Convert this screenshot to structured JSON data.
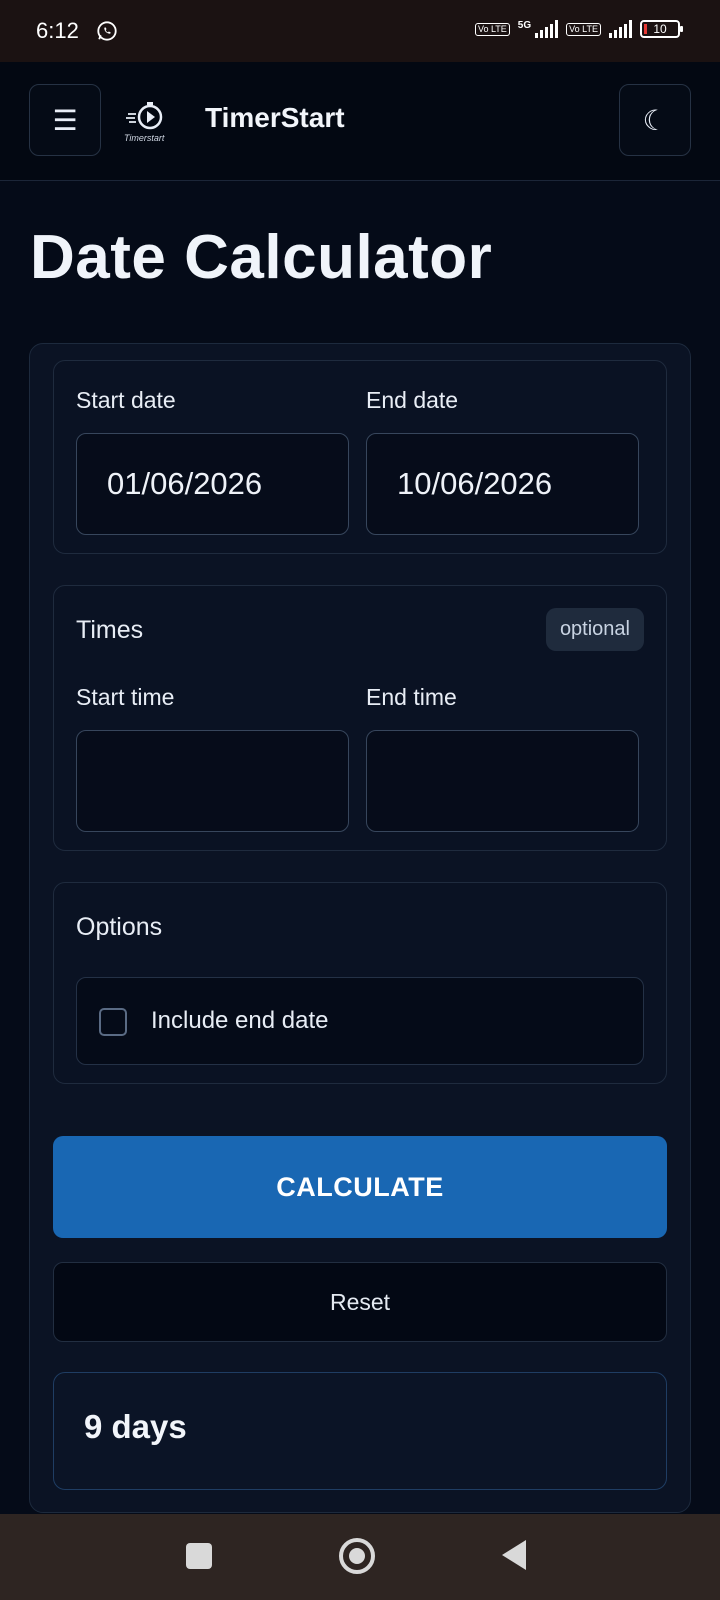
{
  "status_bar": {
    "time": "6:12",
    "network": "5G",
    "sim1_label": "Vo LTE",
    "sim2_label": "Vo LTE",
    "battery": "10"
  },
  "app_bar": {
    "menu_icon": "☰",
    "logo_text": "Timerstart",
    "brand": "TimerStart",
    "theme_icon": "☾"
  },
  "page": {
    "title": "Date Calculator"
  },
  "dates": {
    "start_label": "Start date",
    "start_value": "01/06/2026",
    "end_label": "End date",
    "end_value": "10/06/2026"
  },
  "times": {
    "heading": "Times",
    "badge": "optional",
    "start_label": "Start time",
    "start_value": "",
    "end_label": "End time",
    "end_value": ""
  },
  "options": {
    "heading": "Options",
    "include_end_label": "Include end date",
    "include_end_checked": false
  },
  "actions": {
    "calculate_label": "CALCULATE",
    "reset_label": "Reset"
  },
  "result": {
    "text": "9 days"
  },
  "colors": {
    "background": "#050b18",
    "accent": "#1967b3",
    "card": "#0b1324",
    "status_bar": "#1b1212",
    "nav_bar": "#2e2522"
  },
  "nav_icons": [
    "recents-square-icon",
    "home-circle-icon",
    "back-triangle-icon"
  ]
}
